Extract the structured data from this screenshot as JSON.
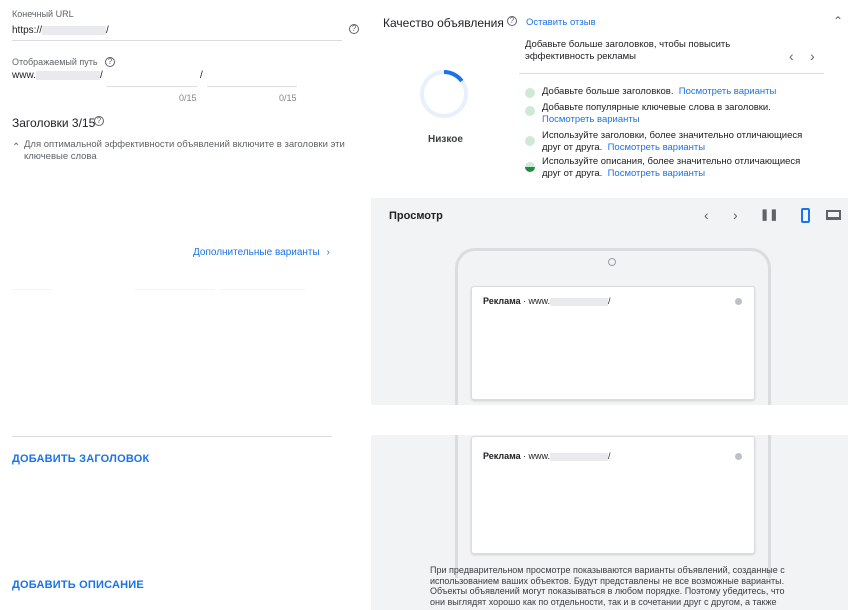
{
  "left": {
    "final_url_label": "Конечный URL",
    "final_url_prefix": "https://",
    "final_url_suffix": "/",
    "display_path_label": "Отображаемый путь",
    "display_path_prefix": "www.",
    "path_sep1": "/",
    "path_sep2": "/",
    "path1_counter": "0/15",
    "path2_counter": "0/15",
    "headlines_title": "Заголовки 3/15",
    "headlines_hint": "Для оптимальной эффективности объявлений включите в заголовки эти ключевые слова",
    "more_variants": "Дополнительные варианты",
    "add_headline": "ДОБАВИТЬ ЗАГОЛОВОК",
    "add_description": "ДОБАВИТЬ ОПИСАНИЕ"
  },
  "quality": {
    "title": "Качество объявления",
    "feedback_link": "Оставить отзыв",
    "suggestion_header": "Добавьте больше заголовков, чтобы повысить эффективность рекламы",
    "rating": "Низкое",
    "rating_fraction": 0.15,
    "items": [
      {
        "text": "Добавьте больше заголовков.",
        "link": "Посмотреть варианты"
      },
      {
        "text": "Добавьте популярные ключевые слова в заголовки.",
        "link": "Посмотреть варианты"
      },
      {
        "text": "Используйте заголовки, более значительно отличающиеся друг от друга.",
        "link": "Посмотреть варианты"
      },
      {
        "text": "Используйте описания, более значительно отличающиеся друг от друга.",
        "link": "Посмотреть варианты"
      }
    ]
  },
  "preview": {
    "title": "Просмотр",
    "ad_label": "Реклама",
    "ad_url_prefix": "www.",
    "ad_url_suffix": "/",
    "footer": "При предварительном просмотре показываются варианты объявлений, созданные с использованием ваших объектов. Будут представлены не все возможные варианты. Объекты объявлений могут показываться в любом порядке. Поэтому убедитесь, что они выглядят хорошо как по отдельности, так и в сочетании друг с другом, а также"
  },
  "colors": {
    "accent": "#1a73e8",
    "ring": "#1a73e8"
  }
}
